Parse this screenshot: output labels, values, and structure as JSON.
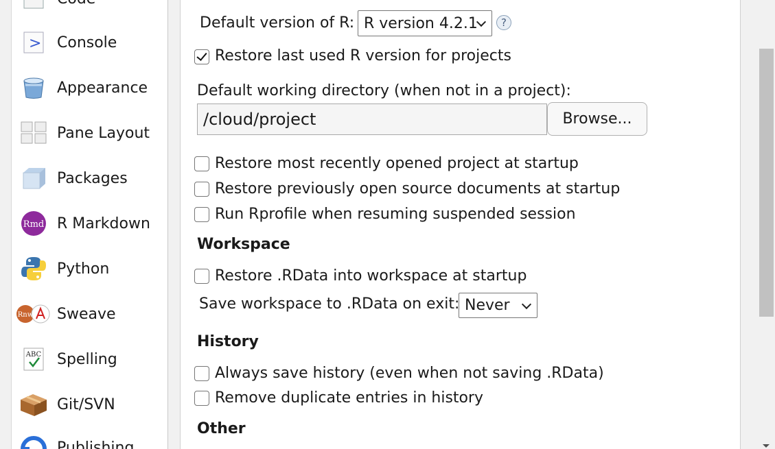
{
  "sidebar": {
    "items": [
      {
        "label": "Code",
        "icon": "code-icon"
      },
      {
        "label": "Console",
        "icon": "console-icon"
      },
      {
        "label": "Appearance",
        "icon": "paint-bucket-icon"
      },
      {
        "label": "Pane Layout",
        "icon": "pane-layout-icon"
      },
      {
        "label": "Packages",
        "icon": "package-cube-icon"
      },
      {
        "label": "R Markdown",
        "icon": "rmd-icon"
      },
      {
        "label": "Python",
        "icon": "python-icon"
      },
      {
        "label": "Sweave",
        "icon": "sweave-icon"
      },
      {
        "label": "Spelling",
        "icon": "spelling-icon"
      },
      {
        "label": "Git/SVN",
        "icon": "git-box-icon"
      },
      {
        "label": "Publishing",
        "icon": "publishing-icon"
      }
    ]
  },
  "general": {
    "r_version_label": "Default version of R:",
    "r_version_value": "R version 4.2.1",
    "help_glyph": "?",
    "restore_r_version_label": "Restore last used R version for projects",
    "restore_r_version_checked": true,
    "working_dir_label": "Default working directory (when not in a project):",
    "working_dir_value": "/cloud/project",
    "browse_label": "Browse...",
    "options": [
      {
        "label": "Restore most recently opened project at startup",
        "checked": false
      },
      {
        "label": "Restore previously open source documents at startup",
        "checked": false
      },
      {
        "label": "Run Rprofile when resuming suspended session",
        "checked": false
      }
    ]
  },
  "workspace": {
    "heading": "Workspace",
    "restore_rdata_label": "Restore .RData into workspace at startup",
    "restore_rdata_checked": false,
    "save_label": "Save workspace to .RData on exit:",
    "save_value": "Never"
  },
  "history": {
    "heading": "History",
    "always_save_label": "Always save history (even when not saving .RData)",
    "always_save_checked": false,
    "remove_dupes_label": "Remove duplicate entries in history",
    "remove_dupes_checked": false
  },
  "other": {
    "heading": "Other"
  },
  "colors": {
    "rmd_purple": "#8e2a9c",
    "console_blue": "#3a5bd0"
  }
}
